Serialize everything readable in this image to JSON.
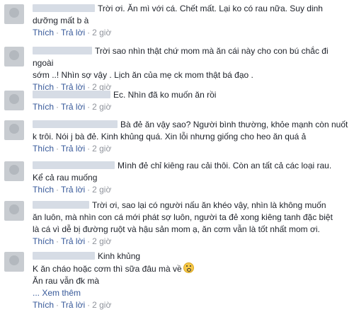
{
  "comments": [
    {
      "lines": [
        "Trời ơi. Ăn mì với cá. Chết mất. Lại ko có rau nữa. Suy dinh",
        "dưỡng mất b à"
      ],
      "like": "Thích",
      "reply": "Trả lời",
      "time": "2 giờ"
    },
    {
      "lines": [
        "Trời sao nhìn thật chứ mom mà ăn cái này cho con bú chắc đi ngoài",
        "sớm ..! Nhìn sợ vậy . Lịch ăn của mẹ ck mom thật bá đạo ."
      ],
      "like": "Thích",
      "reply": "Trả lời",
      "time": "2 giờ"
    },
    {
      "lines": [
        "Ec. Nhìn đã ko muốn ăn rồi"
      ],
      "like": "Thích",
      "reply": "Trả lời",
      "time": "2 giờ"
    },
    {
      "lines": [
        "Bà đẻ ăn vậy sao? Người bình thường, khỏe mạnh còn nuốt",
        "k trôi. Nói j bà đẻ. Kinh khủng quá. Xin lỗi nhưng giống cho heo ăn quá ả"
      ],
      "like": "Thích",
      "reply": "Trả lời",
      "time": "2 giờ"
    },
    {
      "lines": [
        "Mình đẻ chỉ kiêng rau cải thôi. Còn an tất cả các loại rau.",
        "Kể cả rau muống"
      ],
      "like": "Thích",
      "reply": "Trả lời",
      "time": "2 giờ"
    },
    {
      "lines": [
        "Trời ơi, sao lại có người nấu ăn khéo vậy, nhìn là không muốn",
        "ăn luôn, mà nhìn con cá mới phát sợ luôn, người ta đẻ xong kiêng tanh đặc biệt",
        "là cá vì dễ bị đường ruột và hậu sản mom ạ, ăn cơm vẫn là tốt nhất mom ơi."
      ],
      "like": "Thích",
      "reply": "Trả lời",
      "time": "2 giờ"
    },
    {
      "lines": [
        "Kinh khủng",
        "K ăn cháo hoặc cơm thì sữa đâu mà về",
        "Ăn rau vẫn đk mà"
      ],
      "more": "... Xem thêm",
      "like": "Thích",
      "reply": "Trả lời",
      "time": "2 giờ"
    }
  ]
}
